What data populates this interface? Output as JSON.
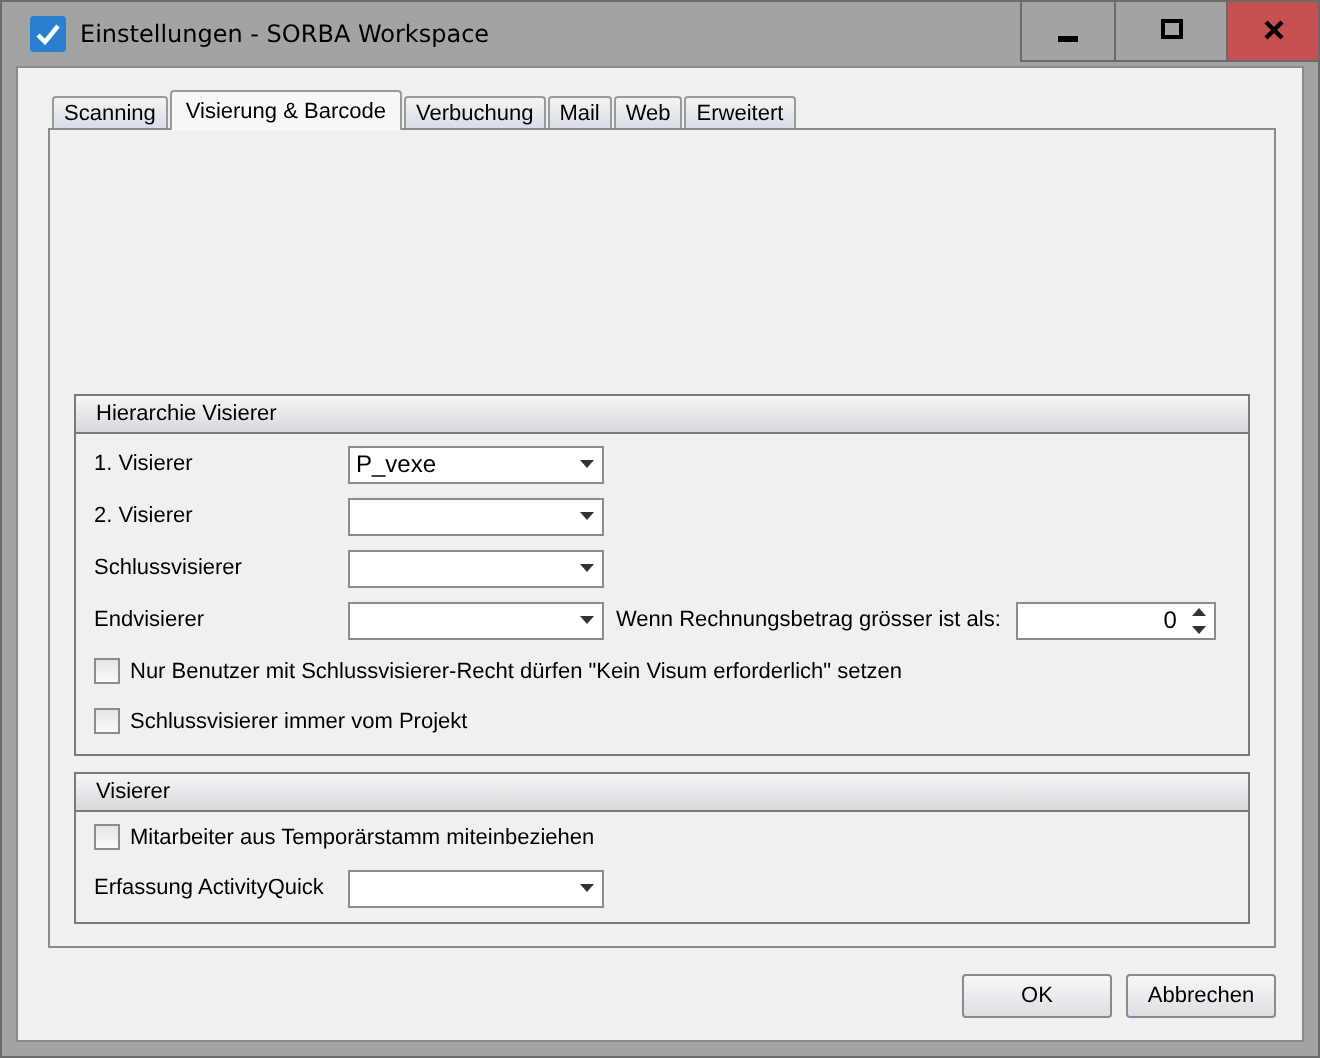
{
  "window": {
    "title": "Einstellungen - SORBA Workspace"
  },
  "tabs": [
    {
      "label": "Scanning",
      "selected": false
    },
    {
      "label": "Visierung & Barcode",
      "selected": true
    },
    {
      "label": "Verbuchung",
      "selected": false
    },
    {
      "label": "Mail",
      "selected": false
    },
    {
      "label": "Web",
      "selected": false
    },
    {
      "label": "Erweitert",
      "selected": false
    }
  ],
  "groups": [
    {
      "title": "Hierarchie Visierer",
      "rows": [
        {
          "kind": "dropdown",
          "label": "1. Visierer",
          "value": "P_vexe"
        },
        {
          "kind": "dropdown",
          "label": "2. Visierer"
        },
        {
          "kind": "dropdown",
          "label": "Schlussvisierer"
        },
        {
          "kind": "dropdown",
          "label": "Endvisierer",
          "extra_label": "Wenn Rechnungsbetrag grösser ist als:",
          "spin_value": "0"
        },
        {
          "kind": "checkbox",
          "label": "Nur Benutzer mit Schlussvisierer-Recht dürfen \"Kein Visum erforderlich\" setzen",
          "checked": false
        },
        {
          "kind": "checkbox",
          "label": "Schlussvisierer immer vom Projekt",
          "checked": false
        }
      ]
    },
    {
      "title": "Visierer",
      "rows": [
        {
          "kind": "checkbox",
          "label": "Mitarbeiter aus Temporärstamm miteinbeziehen",
          "checked": false
        },
        {
          "kind": "dropdown",
          "label": "Erfassung ActivityQuick"
        }
      ]
    }
  ],
  "buttons": [
    "OK",
    "Abbrechen"
  ]
}
